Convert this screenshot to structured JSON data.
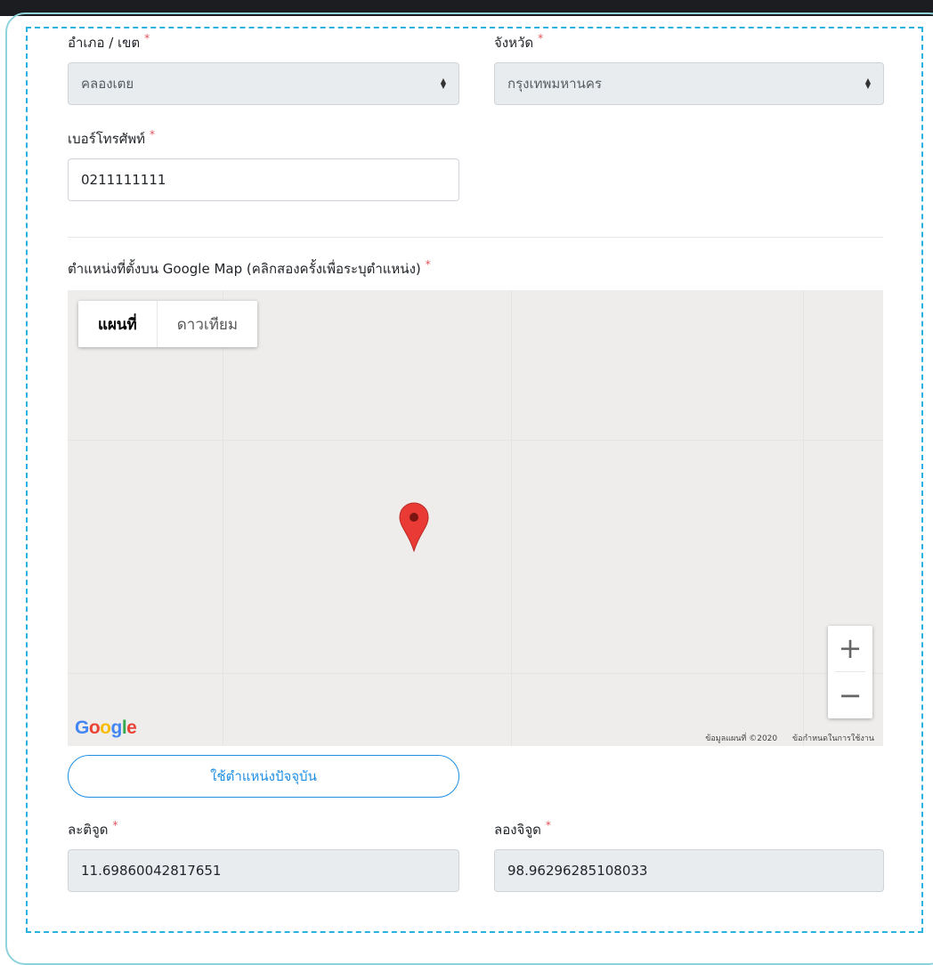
{
  "form": {
    "district": {
      "label": "อำเภอ / เขต",
      "required": "*",
      "value": "คลองเตย"
    },
    "province": {
      "label": "จังหวัด",
      "required": "*",
      "value": "กรุงเทพมหานคร"
    },
    "phone": {
      "label": "เบอร์โทรศัพท์",
      "required": "*",
      "value": "0211111111"
    },
    "map_section": {
      "label": "ตำแหน่งที่ตั้งบน Google Map (คลิกสองครั้งเพื่อระบุตำแหน่ง)",
      "required": "*"
    },
    "use_current_location_label": "ใช้ตำแหน่งปัจจุบัน",
    "latitude": {
      "label": "ละติจูด",
      "required": "*",
      "value": "11.69860042817651"
    },
    "longitude": {
      "label": "ลองจิจูด",
      "required": "*",
      "value": "98.96296285108033"
    }
  },
  "map": {
    "type_map_label": "แผนที่",
    "type_satellite_label": "ดาวเทียม",
    "zoom_in": "+",
    "zoom_out": "−",
    "google_logo": {
      "letters": [
        "G",
        "o",
        "o",
        "g",
        "l",
        "e"
      ],
      "colors": [
        "#4285F4",
        "#EA4335",
        "#FBBC05",
        "#4285F4",
        "#34A853",
        "#EA4335"
      ]
    },
    "map_data_text": "ข้อมูลแผนที่ ©2020",
    "terms_text": "ข้อกำหนดในการใช้งาน",
    "marker_icon": "map-pin-icon"
  },
  "colors": {
    "accent": "#1f8fe4",
    "required": "#e0525b",
    "card_border": "#29b1e0"
  }
}
